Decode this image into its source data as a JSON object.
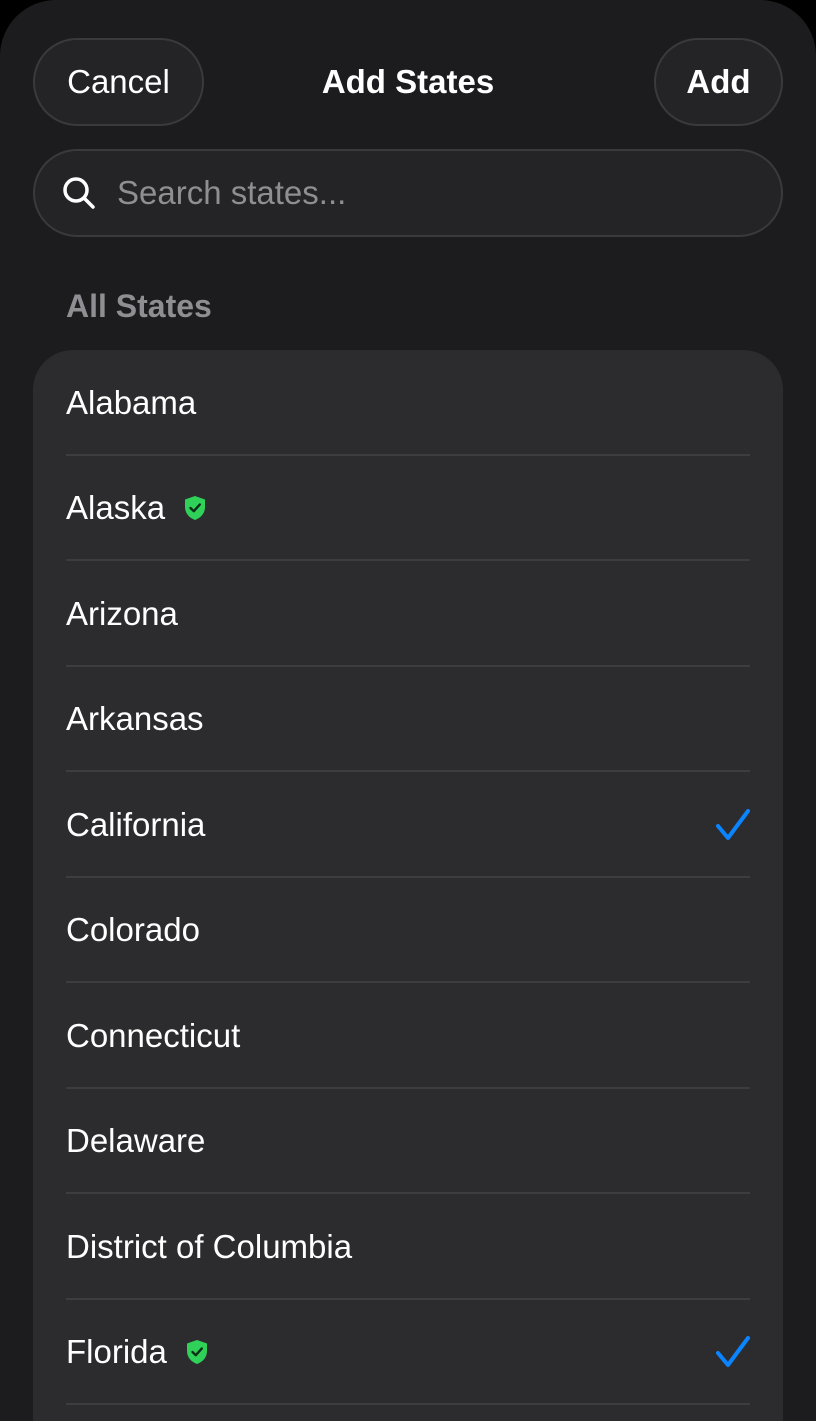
{
  "header": {
    "cancel_label": "Cancel",
    "title": "Add States",
    "add_label": "Add"
  },
  "search": {
    "placeholder": "Search states...",
    "value": ""
  },
  "section": {
    "title": "All States"
  },
  "colors": {
    "accent_check": "#0a84ff",
    "shield_green": "#30d158"
  },
  "states": [
    {
      "name": "Alabama",
      "verified": false,
      "selected": false
    },
    {
      "name": "Alaska",
      "verified": true,
      "selected": false
    },
    {
      "name": "Arizona",
      "verified": false,
      "selected": false
    },
    {
      "name": "Arkansas",
      "verified": false,
      "selected": false
    },
    {
      "name": "California",
      "verified": false,
      "selected": true
    },
    {
      "name": "Colorado",
      "verified": false,
      "selected": false
    },
    {
      "name": "Connecticut",
      "verified": false,
      "selected": false
    },
    {
      "name": "Delaware",
      "verified": false,
      "selected": false
    },
    {
      "name": "District of Columbia",
      "verified": false,
      "selected": false
    },
    {
      "name": "Florida",
      "verified": true,
      "selected": true
    }
  ],
  "icons": {
    "search": "magnifier-icon",
    "verified": "shield-check-icon",
    "selected": "checkmark-icon"
  }
}
